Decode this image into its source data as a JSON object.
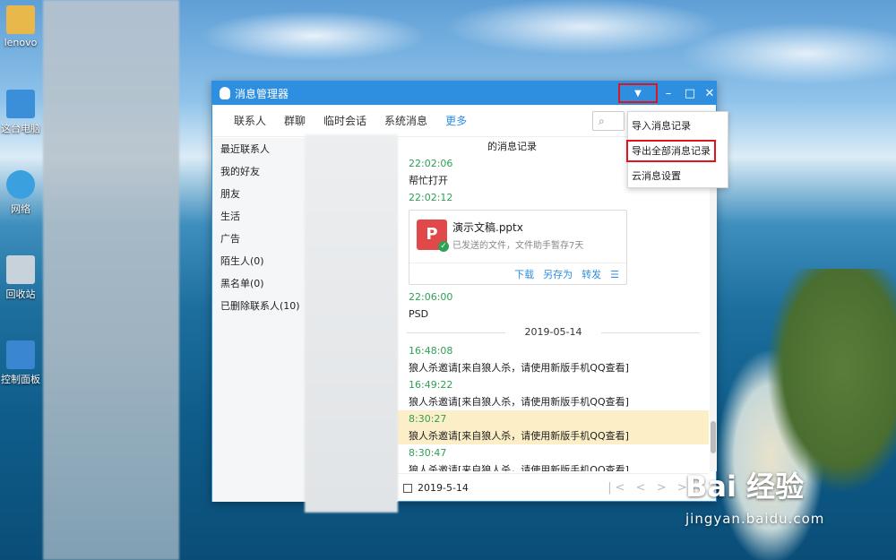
{
  "desktop": {
    "icons": [
      {
        "label": "lenovo",
        "icon": "folder-icon",
        "color": "#e8b84a"
      },
      {
        "label": "这台电脑",
        "icon": "computer-icon",
        "color": "#3b8fd8"
      },
      {
        "label": "网络",
        "icon": "network-globe-icon",
        "color": "#3aa0e0"
      },
      {
        "label": "回收站",
        "icon": "recycle-bin-icon",
        "color": "#c8d2db"
      },
      {
        "label": "控制面板",
        "icon": "control-panel-icon",
        "color": "#3a86d0"
      }
    ]
  },
  "window": {
    "title": "消息管理器",
    "dropdown_glyph": "▼",
    "minimize_glyph": "–",
    "maximize_glyph": "□",
    "close_glyph": "✕",
    "tabs": [
      "联系人",
      "群聊",
      "临时会话",
      "系统消息",
      "更多"
    ],
    "search_glyph": "⌕",
    "sidebar": [
      "最近联系人",
      "我的好友",
      "朋友",
      "生活",
      "广告",
      "陌生人(0)",
      "黑名单(0)",
      "已删除联系人(10)"
    ],
    "messages": {
      "header": "的消息记录",
      "t1": "22:02:06",
      "m1": "帮忙打开",
      "t2": "22:02:12",
      "file_name": "演示文稿.pptx",
      "file_sub": "已发送的文件，文件助手暂存7天",
      "file_badge": "P",
      "file_check": "✓",
      "file_actions": [
        "下载",
        "另存为",
        "转发",
        "☰"
      ],
      "t3": "22:06:00",
      "m3": "PSD",
      "date": "2019-05-14",
      "t4": "16:48:08",
      "m4": "狼人杀邀请[来自狼人杀，请使用新版手机QQ查看]",
      "t5": "16:49:22",
      "m5": "狼人杀邀请[来自狼人杀，请使用新版手机QQ查看]",
      "t6": "8:30:27",
      "m6": "狼人杀邀请[来自狼人杀，请使用新版手机QQ查看]",
      "t7": "8:30:47",
      "m7": "狼人杀邀请[来自狼人杀，请使用新版手机QQ查看]"
    },
    "bottom_date": "2019-5-14",
    "pager": "|< < > >|"
  },
  "menu": {
    "items": [
      "导入消息记录",
      "导出全部消息记录",
      "云消息设置"
    ]
  },
  "watermark": {
    "logo": "Bai 经验",
    "url": "jingyan.baidu.com"
  }
}
